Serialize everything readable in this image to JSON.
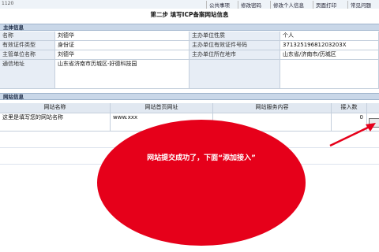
{
  "top": {
    "id": "1120",
    "links": [
      "公共事项",
      "修改密码",
      "修改个人信息",
      "页面打印",
      "常见问题"
    ]
  },
  "title": "第二步 填写ICP备案网站信息",
  "sections": {
    "entity": "主体信息",
    "website": "网站信息"
  },
  "entity": {
    "rows": [
      {
        "label": "名称",
        "value": "刘德华",
        "label2": "主办单位性质",
        "value2": "个人"
      },
      {
        "label": "有效证件类型",
        "value": "身份证",
        "label2": "主办单位有效证件号码",
        "value2": "37132519681203203X"
      },
      {
        "label": "主管单位名称",
        "value": "刘德华",
        "label2": "主办单位所在地市",
        "value2": "山东省/济南市/历城区"
      },
      {
        "label": "通信地址",
        "value": "山东省济南市历城区-好德科技园",
        "label2": "",
        "value2": ""
      }
    ]
  },
  "website": {
    "headers": [
      "网站名称",
      "网站首页网址",
      "网站服务内容",
      "接入数"
    ],
    "rows": [
      {
        "name": "这里是填写您的网站名称",
        "url": "www.xxx",
        "service": "",
        "count": "0"
      }
    ]
  },
  "callout": {
    "text": "网站提交成功了，下面“添加接入”",
    "color": "#e6001a"
  }
}
